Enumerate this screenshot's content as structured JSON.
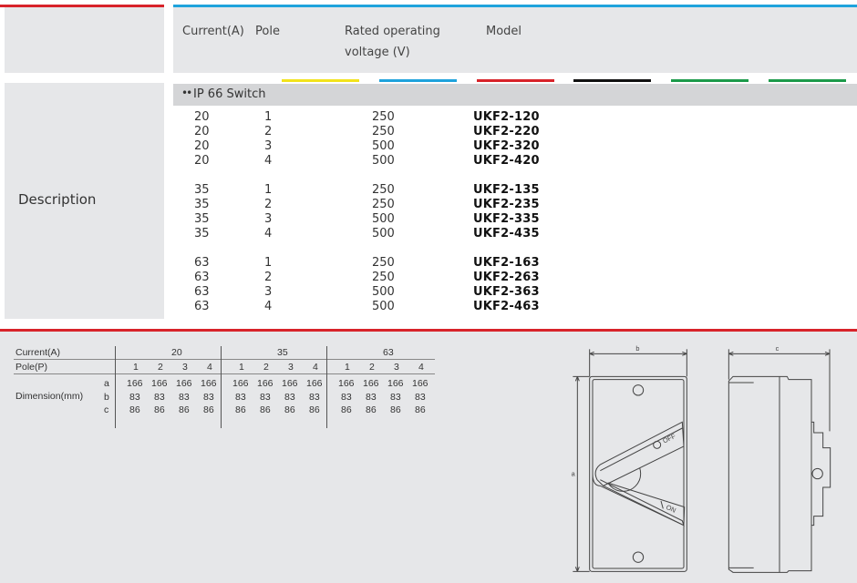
{
  "left_panel": {
    "description_label": "Description"
  },
  "header": {
    "columns": [
      "Current(A)",
      "Pole",
      "Rated operating",
      "voltage (V)",
      "Model"
    ]
  },
  "color_bars": [
    "#f2e31c",
    "#1fa3dc",
    "#d8232a",
    "#111111",
    "#1c9a4a",
    "#1c9a4a"
  ],
  "accent": {
    "red": "#d8232a",
    "blue": "#1fa3dc"
  },
  "section": {
    "icon": "water-drops-icon",
    "icon_glyph": "••",
    "title": "IP 66 Switch"
  },
  "rows": [
    {
      "current": "20",
      "pole": "1",
      "voltage": "250",
      "model": "UKF2-120"
    },
    {
      "current": "20",
      "pole": "2",
      "voltage": "250",
      "model": "UKF2-220"
    },
    {
      "current": "20",
      "pole": "3",
      "voltage": "500",
      "model": "UKF2-320"
    },
    {
      "current": "20",
      "pole": "4",
      "voltage": "500",
      "model": "UKF2-420"
    },
    {
      "current": "35",
      "pole": "1",
      "voltage": "250",
      "model": "UKF2-135"
    },
    {
      "current": "35",
      "pole": "2",
      "voltage": "250",
      "model": "UKF2-235"
    },
    {
      "current": "35",
      "pole": "3",
      "voltage": "500",
      "model": "UKF2-335"
    },
    {
      "current": "35",
      "pole": "4",
      "voltage": "500",
      "model": "UKF2-435"
    },
    {
      "current": "63",
      "pole": "1",
      "voltage": "250",
      "model": "UKF2-163"
    },
    {
      "current": "63",
      "pole": "2",
      "voltage": "250",
      "model": "UKF2-263"
    },
    {
      "current": "63",
      "pole": "3",
      "voltage": "500",
      "model": "UKF2-363"
    },
    {
      "current": "63",
      "pole": "4",
      "voltage": "500",
      "model": "UKF2-463"
    }
  ],
  "dimensions": {
    "current_label": "Current(A)",
    "pole_label": "Pole(P)",
    "dimension_label": "Dimension(mm)",
    "groups": [
      "20",
      "35",
      "63"
    ],
    "poles": [
      "1",
      "2",
      "3",
      "4"
    ],
    "rows": [
      {
        "key": "a",
        "values": [
          "166",
          "166",
          "166",
          "166",
          "166",
          "166",
          "166",
          "166",
          "166",
          "166",
          "166",
          "166"
        ]
      },
      {
        "key": "b",
        "values": [
          "83",
          "83",
          "83",
          "83",
          "83",
          "83",
          "83",
          "83",
          "83",
          "83",
          "83",
          "83"
        ]
      },
      {
        "key": "c",
        "values": [
          "86",
          "86",
          "86",
          "86",
          "86",
          "86",
          "86",
          "86",
          "86",
          "86",
          "86",
          "86"
        ]
      }
    ]
  },
  "drawing": {
    "dim_a": "a",
    "dim_b": "b",
    "dim_c": "c",
    "off_label": "OFF",
    "on_label": "ON"
  }
}
